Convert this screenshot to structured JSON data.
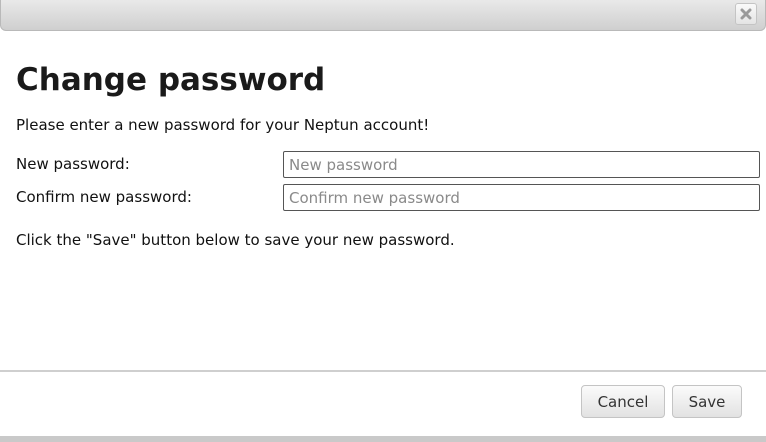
{
  "dialog": {
    "close_icon": "close-x-icon",
    "title": "Change password",
    "intro_text": "Please enter a new password for your Neptun account!",
    "fields": {
      "new_password": {
        "label": "New password:",
        "placeholder": "New password",
        "value": ""
      },
      "confirm_password": {
        "label": "Confirm new password:",
        "placeholder": "Confirm new password",
        "value": ""
      }
    },
    "hint_text": "Click the \"Save\" button below to save your new password.",
    "buttons": {
      "cancel_label": "Cancel",
      "save_label": "Save"
    }
  },
  "colors": {
    "titlebar": "#d8d8d8",
    "input_border": "#555555",
    "button_border": "#c4c4c4"
  }
}
